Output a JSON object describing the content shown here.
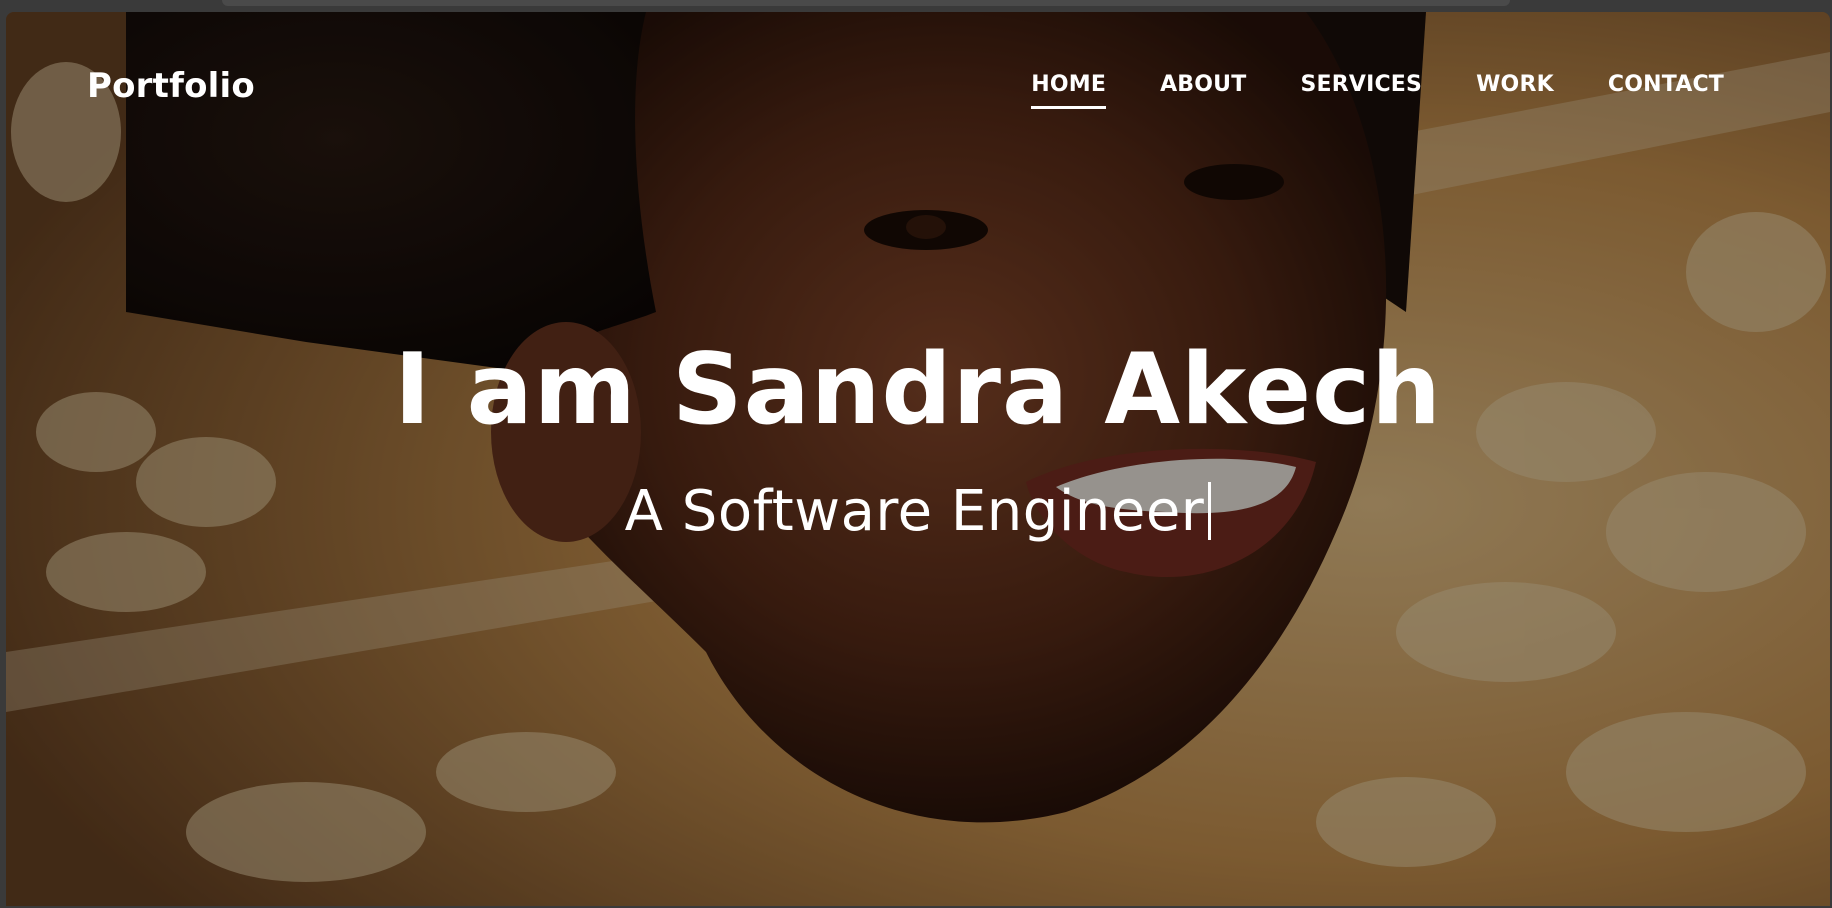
{
  "navbar": {
    "logo": "Portfolio",
    "links": [
      {
        "label": "HOME",
        "active": true
      },
      {
        "label": "ABOUT",
        "active": false
      },
      {
        "label": "SERVICES",
        "active": false
      },
      {
        "label": "WORK",
        "active": false
      },
      {
        "label": "CONTACT",
        "active": false
      }
    ]
  },
  "hero": {
    "title": "I am Sandra Akech",
    "subtitle": "A Software Engineer"
  },
  "colors": {
    "text": "#ffffff",
    "overlay": "rgba(0,0,0,0.38)",
    "background_warm": "#c89a5a"
  }
}
